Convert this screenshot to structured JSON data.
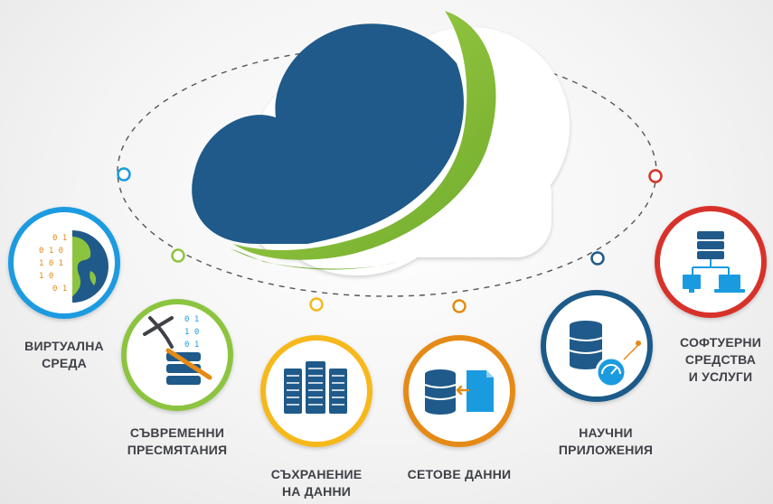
{
  "colors": {
    "navy": "#1f5a8a",
    "green": "#8cc43f",
    "blue": "#1a9be0",
    "yellow": "#f7b81c",
    "orange": "#e58a14",
    "red": "#d7322b",
    "text": "#3f4147"
  },
  "cloud": {
    "icon": "cloud-logo"
  },
  "services": [
    {
      "id": "virtual",
      "label": "ВИРТУАЛНА\nСРЕДА",
      "icon": "globe-binary-icon",
      "color": "#1a9be0"
    },
    {
      "id": "computing",
      "label": "СЪВРЕМЕННИ\nПРЕСМЯТАНИЯ",
      "icon": "pickaxe-database-icon",
      "color": "#8cc43f"
    },
    {
      "id": "storage",
      "label": "СЪХРАНЕНИЕ\nНА ДАННИ",
      "icon": "server-racks-icon",
      "color": "#f7b81c"
    },
    {
      "id": "datasets",
      "label": "СЕТОВЕ ДАННИ",
      "icon": "database-document-icon",
      "color": "#e58a14"
    },
    {
      "id": "science",
      "label": "НАУЧНИ\nПРИЛОЖЕНИЯ",
      "icon": "database-gauge-icon",
      "color": "#1f5a8a"
    },
    {
      "id": "software",
      "label": "СОФТУЕРНИ\nСРЕДСТВА\nИ УСЛУГИ",
      "icon": "network-devices-icon",
      "color": "#d7322b"
    }
  ],
  "binary": [
    "0 1",
    "0 1 0",
    "1 0 1",
    "1 0",
    "0 1"
  ],
  "binary2": [
    "0 1",
    "1 0",
    "0 1"
  ]
}
